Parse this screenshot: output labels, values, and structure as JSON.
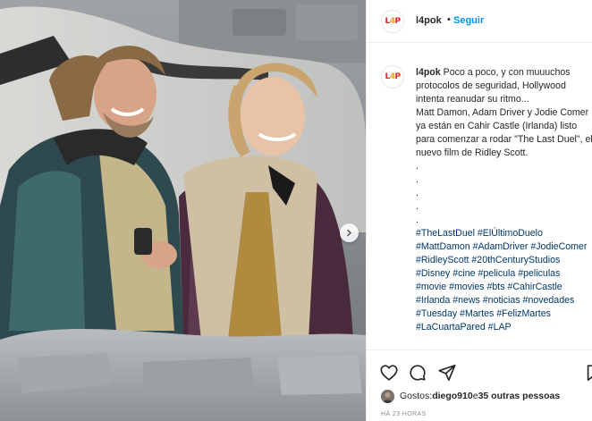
{
  "post": {
    "image_alt": "photo",
    "carousel_next": "next"
  },
  "header": {
    "username": "l4pok",
    "separator": "•",
    "follow_label": "Seguir"
  },
  "logo": {
    "text_a": "L",
    "text_b": "4",
    "text_c": "P"
  },
  "caption": {
    "username": "l4pok",
    "text": "Poco a poco, y con muuuchos protocolos de seguridad, Hollywood intenta reanudar su ritmo...\nMatt Damon, Adam Driver y Jodie Comer ya están en Cahir Castle (Irlanda) listo para comenzar a rodar \"The Last Duel\", el nuevo film de Ridley Scott.\n.\n.\n.\n.\n.\n",
    "hashtags": "#TheLastDuel #ElÚltimoDuelo #MattDamon #AdamDriver #JodieComer #RidleyScott #20thCenturyStudios #Disney #cine #pelicula #peliculas #movie #movies #bts #CahirCastle #Irlanda #news #noticias #novedades #Tuesday #Martes #FelizMartes #LaCuartaPared #LAP"
  },
  "actions": {
    "like_icon": "heart-icon",
    "comment_icon": "comment-icon",
    "share_icon": "share-icon",
    "save_icon": "bookmark-icon"
  },
  "likes": {
    "prefix": "Gostos: ",
    "user": "diego910",
    "middle": " e ",
    "others": "35 outras pessoas"
  },
  "timestamp": "HÁ 23 HORAS"
}
